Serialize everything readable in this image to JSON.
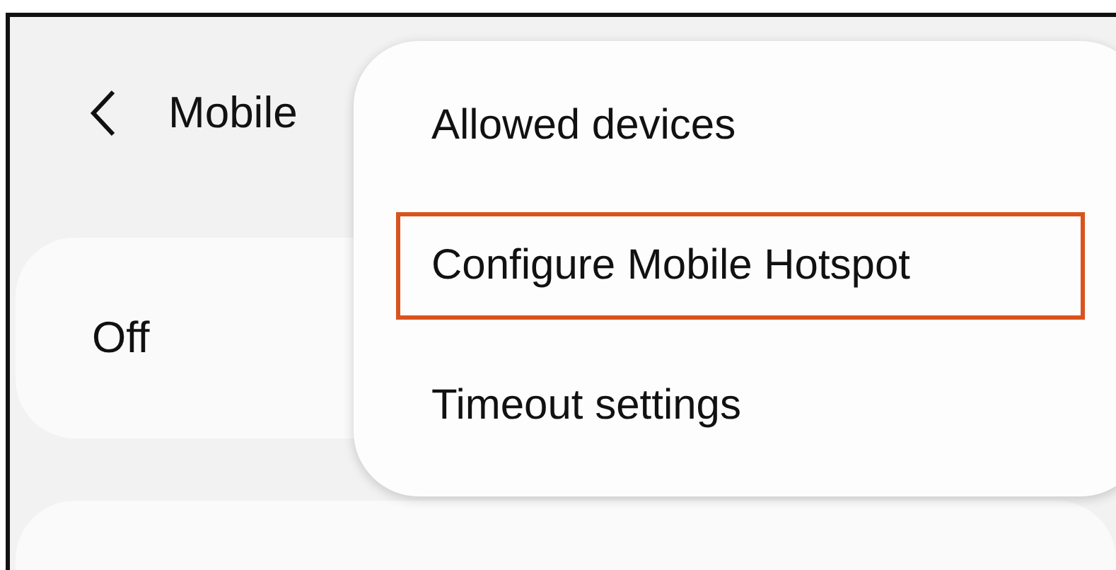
{
  "header": {
    "title": "Mobile"
  },
  "status_card": {
    "label": "Off"
  },
  "menu": {
    "items": [
      {
        "label": "Allowed devices",
        "highlighted": false
      },
      {
        "label": "Configure Mobile Hotspot",
        "highlighted": true
      },
      {
        "label": "Timeout settings",
        "highlighted": false
      }
    ]
  }
}
